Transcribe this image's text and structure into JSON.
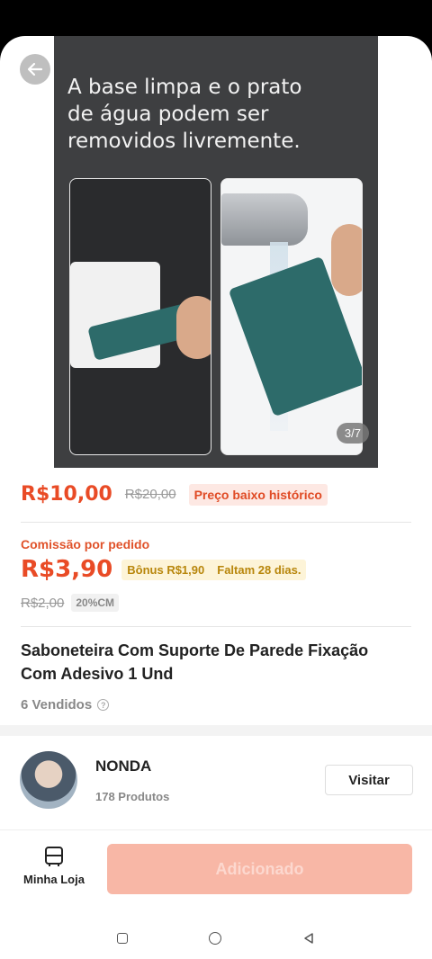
{
  "hero": {
    "caption": "A base limpa e o prato de água podem ser removidos livremente.",
    "page_indicator": "3/7"
  },
  "price": {
    "current": "R$10,00",
    "original": "R$20,00",
    "badge": "Preço baixo histórico"
  },
  "commission": {
    "label": "Comissão por pedido",
    "value": "R$3,90",
    "bonus": "Bônus R$1,90",
    "days_left": "Faltam 28 dias.",
    "old_value": "R$2,00",
    "rate": "20%CM"
  },
  "product": {
    "title": "Saboneteira Com Suporte De Parede Fixação Com Adesivo 1 Und",
    "sold": "6 Vendidos"
  },
  "store": {
    "name": "NONDA",
    "products": "178 Produtos",
    "visit_label": "Visitar"
  },
  "bottom": {
    "my_store_label": "Minha Loja",
    "add_label": "Adicionado"
  },
  "colors": {
    "accent": "#e94b26",
    "add_button": "#f8b7a6"
  }
}
